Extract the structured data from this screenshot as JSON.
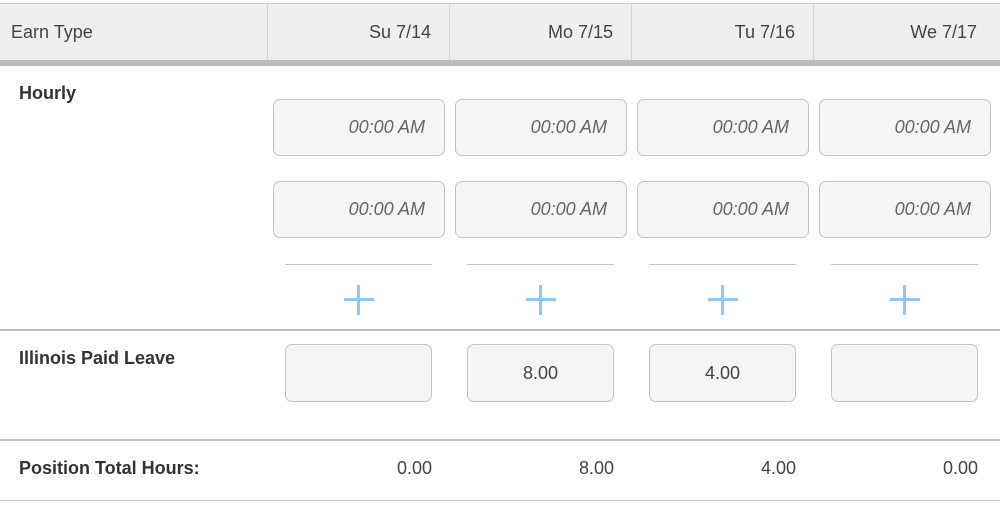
{
  "header": {
    "earn_type": "Earn Type",
    "days": [
      "Su 7/14",
      "Mo 7/15",
      "Tu 7/16",
      "We 7/17"
    ]
  },
  "hourly": {
    "label": "Hourly",
    "time_in": [
      "00:00 AM",
      "00:00 AM",
      "00:00 AM",
      "00:00 AM"
    ],
    "time_out": [
      "00:00 AM",
      "00:00 AM",
      "00:00 AM",
      "00:00 AM"
    ],
    "add_icon": "plus-icon"
  },
  "leave": {
    "label": "Illinois Paid Leave",
    "values": [
      "",
      "8.00",
      "4.00",
      ""
    ]
  },
  "totals": {
    "label": "Position Total Hours:",
    "values": [
      "0.00",
      "8.00",
      "4.00",
      "0.00"
    ]
  },
  "colors": {
    "accent": "#8fc8f7",
    "header_bg": "#efefef",
    "input_bg": "#f5f5f5"
  }
}
